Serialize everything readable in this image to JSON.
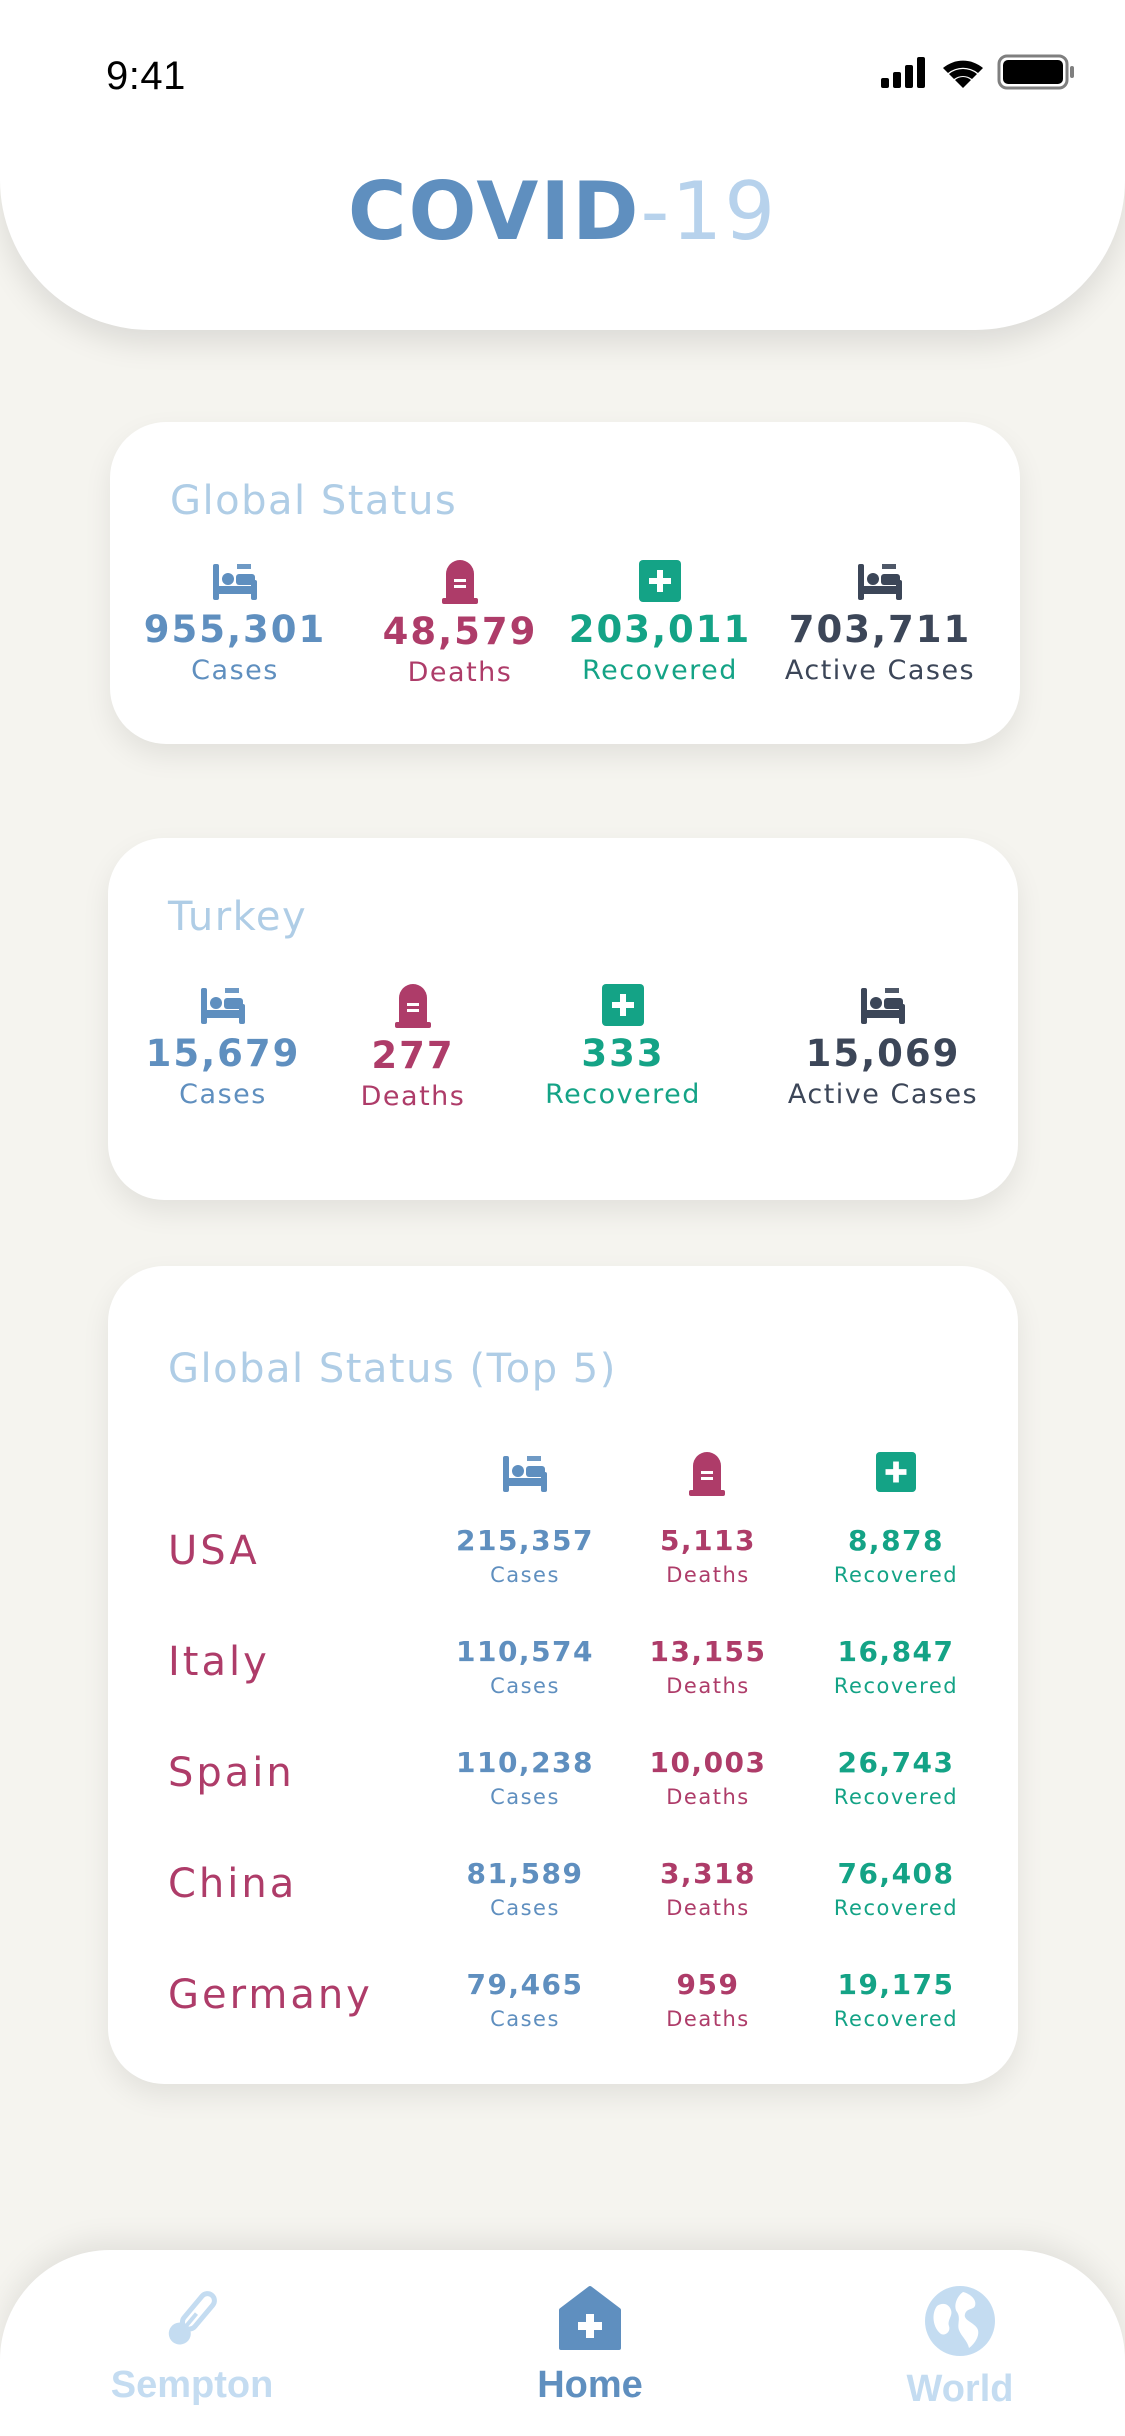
{
  "status_bar": {
    "time": "9:41"
  },
  "header": {
    "title_main": "COVID",
    "title_sub": "-19"
  },
  "colors": {
    "cases": "#5F8FBF",
    "deaths": "#AE3C69",
    "recovered": "#14A386",
    "active": "#3C4658",
    "card_title": "#AFCDE6",
    "background": "#F5F4EF"
  },
  "global": {
    "title": "Global Status",
    "cases": {
      "value": "955,301",
      "label": "Cases",
      "icon": "bed-icon"
    },
    "deaths": {
      "value": "48,579",
      "label": "Deaths",
      "icon": "tombstone-icon"
    },
    "recovered": {
      "value": "203,011",
      "label": "Recovered",
      "icon": "medical-cross-icon"
    },
    "active": {
      "value": "703,711",
      "label": "Active Cases",
      "icon": "bed-icon"
    }
  },
  "turkey": {
    "title": "Turkey",
    "cases": {
      "value": "15,679",
      "label": "Cases"
    },
    "deaths": {
      "value": "277",
      "label": "Deaths"
    },
    "recovered": {
      "value": "333",
      "label": "Recovered"
    },
    "active": {
      "value": "15,069",
      "label": "Active Cases"
    }
  },
  "top5": {
    "title": "Global Status (Top 5)",
    "labels": {
      "cases": "Cases",
      "deaths": "Deaths",
      "recovered": "Recovered"
    },
    "rows": [
      {
        "country": "USA",
        "cases": "215,357",
        "deaths": "5,113",
        "recovered": "8,878"
      },
      {
        "country": "Italy",
        "cases": "110,574",
        "deaths": "13,155",
        "recovered": "16,847"
      },
      {
        "country": "Spain",
        "cases": "110,238",
        "deaths": "10,003",
        "recovered": "26,743"
      },
      {
        "country": "China",
        "cases": "81,589",
        "deaths": "3,318",
        "recovered": "76,408"
      },
      {
        "country": "Germany",
        "cases": "79,465",
        "deaths": "959",
        "recovered": "19,175"
      }
    ]
  },
  "nav": {
    "items": [
      {
        "label": "Sempton",
        "icon": "thermometer-icon",
        "active": false
      },
      {
        "label": "Home",
        "icon": "home-icon",
        "active": true
      },
      {
        "label": "World",
        "icon": "globe-icon",
        "active": false
      }
    ]
  }
}
